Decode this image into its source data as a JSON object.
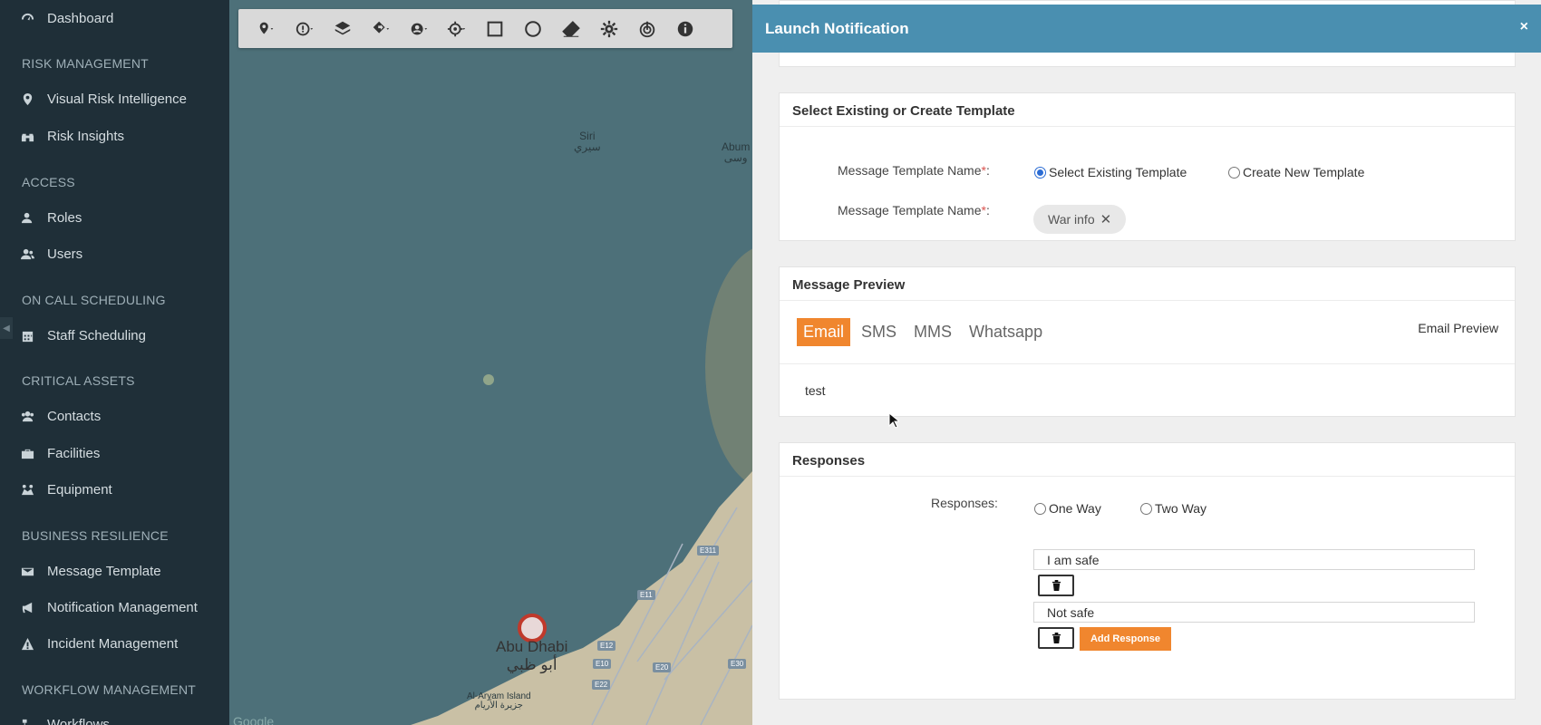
{
  "sidebar": {
    "top_item": "Dashboard",
    "sections": [
      {
        "title": "RISK MANAGEMENT",
        "items": [
          {
            "label": "Visual Risk Intelligence",
            "icon": "map-marker-icon"
          },
          {
            "label": "Risk Insights",
            "icon": "binoculars-icon"
          }
        ]
      },
      {
        "title": "ACCESS",
        "items": [
          {
            "label": "Roles",
            "icon": "user-role-icon"
          },
          {
            "label": "Users",
            "icon": "users-icon"
          }
        ]
      },
      {
        "title": "ON CALL SCHEDULING",
        "items": [
          {
            "label": "Staff Scheduling",
            "icon": "calendar-icon"
          }
        ]
      },
      {
        "title": "CRITICAL ASSETS",
        "items": [
          {
            "label": "Contacts",
            "icon": "contacts-icon"
          },
          {
            "label": "Facilities",
            "icon": "briefcase-icon"
          },
          {
            "label": "Equipment",
            "icon": "equipment-icon"
          }
        ]
      },
      {
        "title": "BUSINESS RESILIENCE",
        "items": [
          {
            "label": "Message Template",
            "icon": "envelope-icon"
          },
          {
            "label": "Notification Management",
            "icon": "bullhorn-icon"
          },
          {
            "label": "Incident Management",
            "icon": "warning-icon"
          }
        ]
      },
      {
        "title": "WORKFLOW MANAGEMENT",
        "items": [
          {
            "label": "Workflows",
            "icon": "workflow-icon"
          }
        ]
      }
    ]
  },
  "map": {
    "labels": {
      "siri_en": "Siri",
      "siri_ar": "سيري",
      "abumusa_en": "Abum",
      "abumusa_ar": "وسى",
      "abudhabi_en": "Abu Dhabi",
      "abudhabi_ar": "أبو ظبي",
      "aryam_en": "Al-Aryam Island",
      "aryam_ar": "جزيرة الأريام",
      "google": "Google"
    },
    "road_badges": [
      "E311",
      "E11",
      "E10",
      "E22",
      "E20",
      "E30",
      "E12"
    ]
  },
  "modal": {
    "title": "Launch Notification",
    "close": "×",
    "template_panel": {
      "heading": "Select Existing or Create Template",
      "label1": "Message Template Name",
      "label2": "Message Template Name",
      "required_mark": "*",
      "colon": ":",
      "radio_existing": "Select Existing Template",
      "radio_new": "Create New Template",
      "selected_template": "War info",
      "chip_remove": "✕"
    },
    "preview_panel": {
      "heading": "Message Preview",
      "tabs": [
        "Email",
        "SMS",
        "MMS",
        "Whatsapp"
      ],
      "active_tab": "Email",
      "preview_label": "Email Preview",
      "body": "test"
    },
    "responses_panel": {
      "heading": "Responses",
      "label": "Responses:",
      "radio_one": "One Way",
      "radio_two": "Two Way",
      "responses": [
        "I am safe",
        "Not safe"
      ],
      "add_button": "Add Response"
    }
  },
  "colors": {
    "header": "#4a8fb0",
    "accent": "#f0862e",
    "sidebar": "#1f2f38"
  }
}
